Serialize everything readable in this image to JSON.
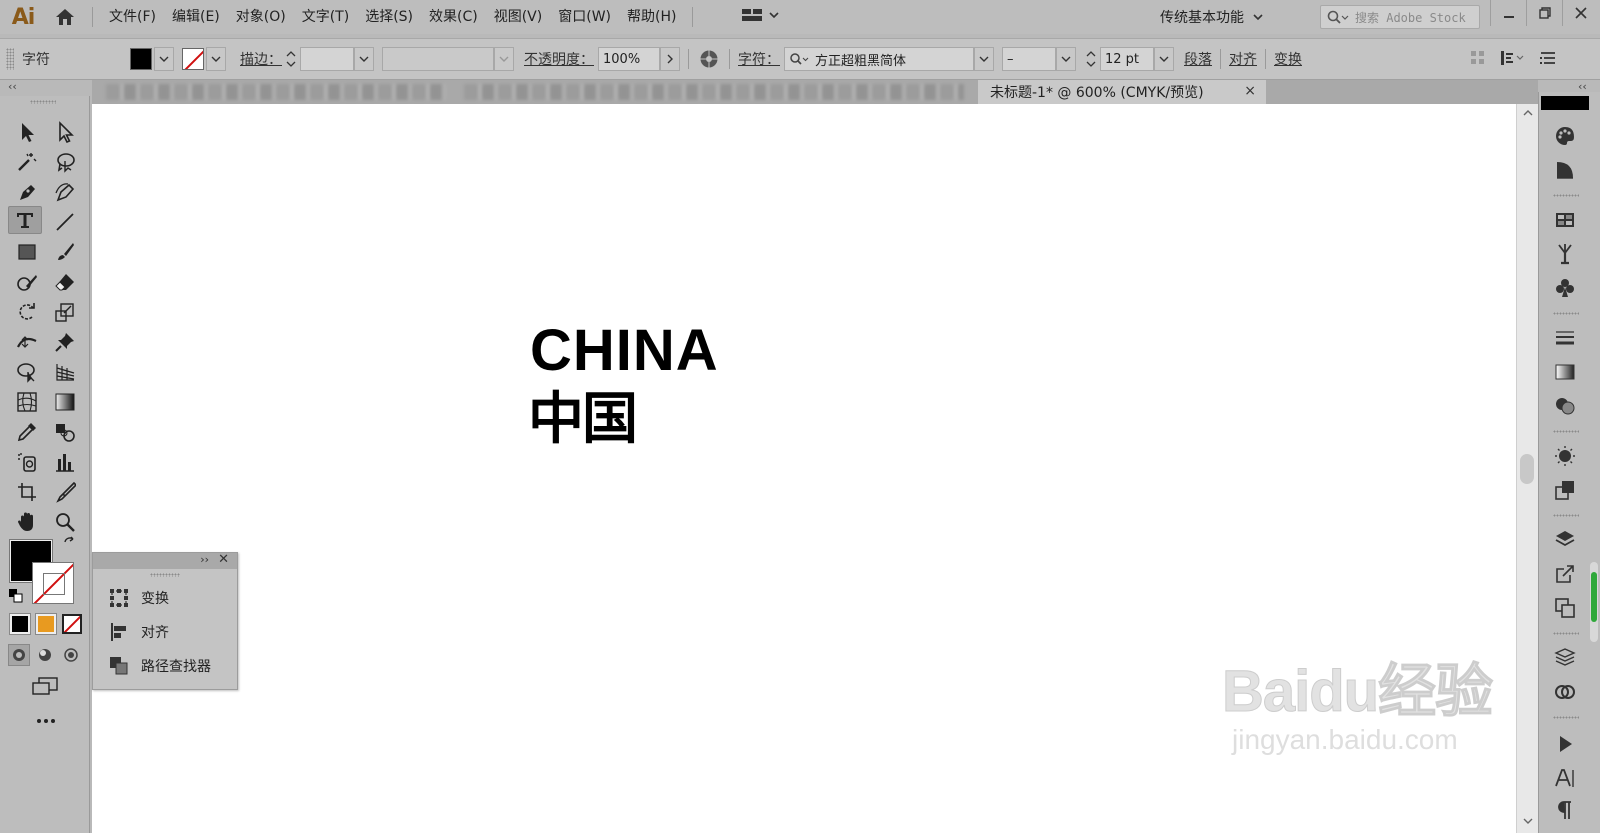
{
  "app": {
    "logo": "Ai"
  },
  "menu": [
    "文件(F)",
    "编辑(E)",
    "对象(O)",
    "文字(T)",
    "选择(S)",
    "效果(C)",
    "视图(V)",
    "窗口(W)",
    "帮助(H)"
  ],
  "workspace": {
    "name": "传统基本功能"
  },
  "stock_search": {
    "placeholder": "搜索 Adobe Stock"
  },
  "control_bar": {
    "mode_label": "字符",
    "stroke_label": "描边：",
    "opacity_label": "不透明度：",
    "opacity_value": "100%",
    "character_label": "字符：",
    "font_family": "方正超粗黑简体",
    "font_style": "–",
    "font_size": "12 pt",
    "paragraph_label": "段落",
    "align_label": "对齐",
    "transform_label": "变换"
  },
  "document_tab": {
    "title": "未标题-1* @ 600% (CMYK/预览)",
    "close": "×"
  },
  "artwork": {
    "line1": "CHINA",
    "line2": "中国"
  },
  "watermark": {
    "brand": "Baidu经验",
    "url": "jingyan.baidu.com"
  },
  "floating_panel": {
    "items": [
      {
        "label": "变换",
        "icon": "transform-icon"
      },
      {
        "label": "对齐",
        "icon": "align-icon"
      },
      {
        "label": "路径查找器",
        "icon": "pathfinder-icon"
      }
    ]
  },
  "colors": {
    "fill": "#000000",
    "stroke": "none",
    "accent_red": "#d01010",
    "dock_scroll_green": "#2fa83a"
  }
}
